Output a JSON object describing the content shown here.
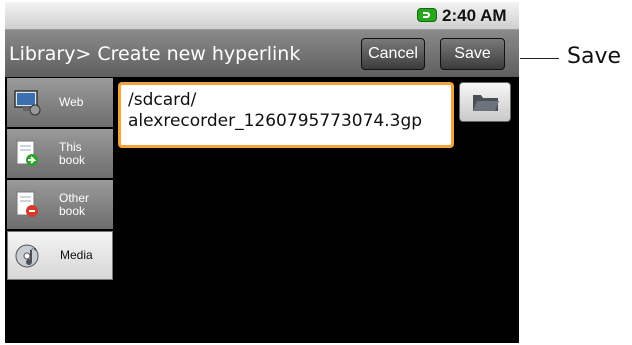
{
  "status": {
    "time": "2:40 AM",
    "battery_icon": "battery-charging-icon"
  },
  "header": {
    "title": "Library> Create new hyperlink",
    "cancel_label": "Cancel",
    "save_label": "Save"
  },
  "sidebar": {
    "tabs": [
      {
        "line1": "Web",
        "line2": "",
        "icon": "monitor-icon",
        "selected": false
      },
      {
        "line1": "This",
        "line2": "book",
        "icon": "book-arrow-icon",
        "selected": false
      },
      {
        "line1": "Other",
        "line2": "book",
        "icon": "book-error-icon",
        "selected": false
      },
      {
        "line1": "Media",
        "line2": "",
        "icon": "media-icon",
        "selected": true
      }
    ]
  },
  "link": {
    "path_line1": "/sdcard/",
    "path_line2": "alexrecorder_1260795773074.3gp",
    "browse_icon": "folder-icon"
  },
  "annotation": {
    "label": "Save"
  },
  "colors": {
    "field_border": "#f0a43c",
    "title_bar": "#6f6f6f",
    "background": "#000000"
  }
}
